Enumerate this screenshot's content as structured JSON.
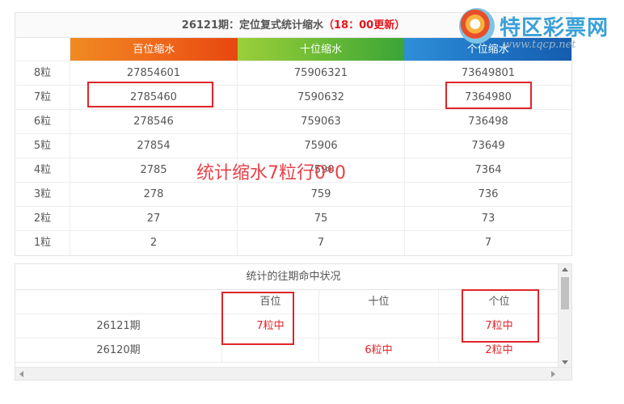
{
  "top_table": {
    "title_main": "26121期：定位复式统计缩水",
    "title_accent": "（18：00更新）",
    "columns": [
      "百位缩水",
      "十位缩水",
      "个位缩水"
    ],
    "rows": [
      {
        "label": "8粒",
        "values": [
          "27854601",
          "75906321",
          "73649801"
        ]
      },
      {
        "label": "7粒",
        "values": [
          "2785460",
          "7590632",
          "7364980"
        ]
      },
      {
        "label": "6粒",
        "values": [
          "278546",
          "759063",
          "736498"
        ]
      },
      {
        "label": "5粒",
        "values": [
          "27854",
          "75906",
          "73649"
        ]
      },
      {
        "label": "4粒",
        "values": [
          "2785",
          "7590",
          "7364"
        ]
      },
      {
        "label": "3粒",
        "values": [
          "278",
          "759",
          "736"
        ]
      },
      {
        "label": "2粒",
        "values": [
          "27",
          "75",
          "73"
        ]
      },
      {
        "label": "1粒",
        "values": [
          "2",
          "7",
          "7"
        ]
      }
    ]
  },
  "overlay_text": "统计缩水7粒行0*0",
  "logo": {
    "name": "特区彩票网",
    "url": "www.tqcp.net"
  },
  "history": {
    "title": "统计的往期命中状况",
    "columns": [
      "百位",
      "十位",
      "个位"
    ],
    "rows": [
      {
        "period": "26121期",
        "values": [
          "7粒中",
          "",
          "7粒中"
        ]
      },
      {
        "period": "26120期",
        "values": [
          "",
          "6粒中",
          "2粒中"
        ]
      }
    ]
  },
  "colors": {
    "accent_red": "#e0242a",
    "header_orange": "#ef6a1b",
    "header_green": "#6cbb35",
    "header_blue": "#1f74c4",
    "logo_blue": "#3aa0d8"
  }
}
